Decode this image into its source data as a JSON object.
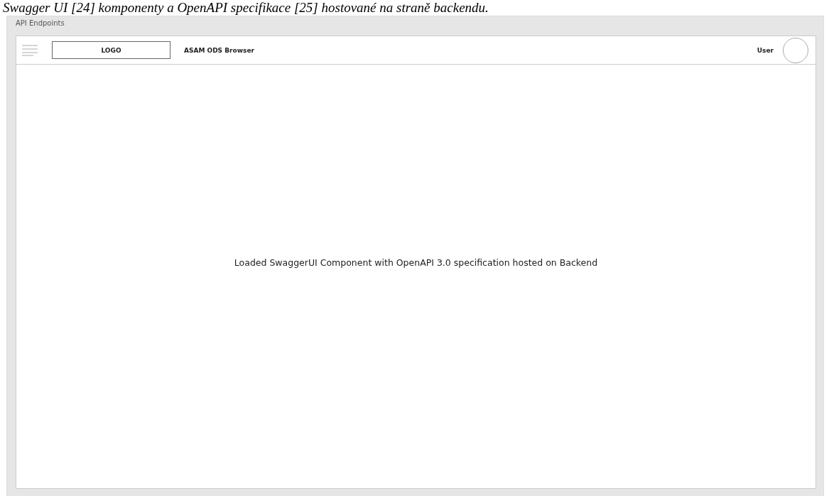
{
  "caption": "Swagger UI [24] komponenty a OpenAPI specifikace [25] hostované na straně backendu.",
  "window": {
    "title": "API Endpoints"
  },
  "header": {
    "logo": "LOGO",
    "app_title": "ASAM ODS Browser",
    "user": "User"
  },
  "content": {
    "message": "Loaded SwaggerUI Component with OpenAPI 3.0 specification hosted on Backend"
  }
}
